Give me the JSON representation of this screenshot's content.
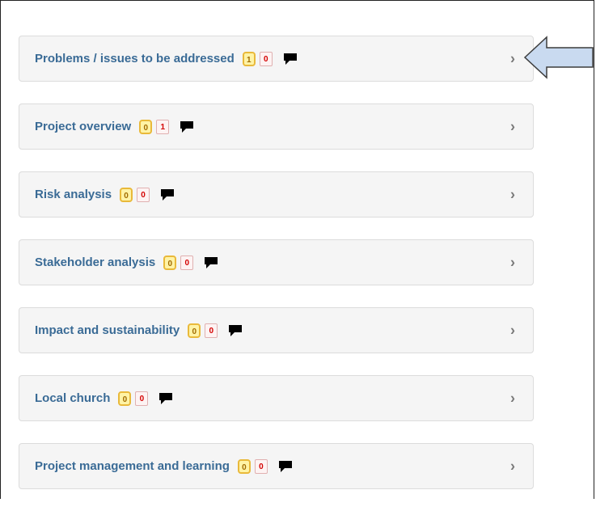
{
  "sections": [
    {
      "label": "Problems / issues to be addressed",
      "count_yellow": "1",
      "count_red": "0"
    },
    {
      "label": "Project overview",
      "count_yellow": "0",
      "count_red": "1"
    },
    {
      "label": "Risk analysis",
      "count_yellow": "0",
      "count_red": "0"
    },
    {
      "label": "Stakeholder analysis",
      "count_yellow": "0",
      "count_red": "0"
    },
    {
      "label": "Impact and sustainability",
      "count_yellow": "0",
      "count_red": "0"
    },
    {
      "label": "Local church",
      "count_yellow": "0",
      "count_red": "0"
    },
    {
      "label": "Project management and learning",
      "count_yellow": "0",
      "count_red": "0"
    }
  ],
  "icons": {
    "comment": "comment-icon",
    "expand": "chevron-right-icon",
    "pointer": "left-arrow-icon"
  },
  "colors": {
    "label": "#3a6b96",
    "badge_yellow_border": "#e9b93a",
    "badge_red_text": "#d40000",
    "arrow_fill": "#c9daf0",
    "arrow_stroke": "#3c3c3c"
  }
}
